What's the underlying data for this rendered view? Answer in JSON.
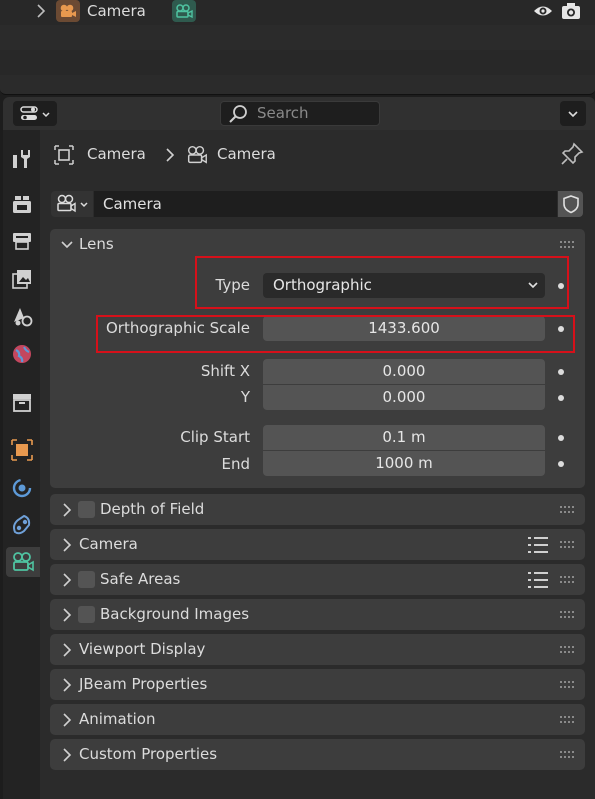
{
  "outliner": {
    "object_name": "Camera"
  },
  "header": {
    "search_placeholder": "Search"
  },
  "breadcrumb": {
    "object": "Camera",
    "data": "Camera"
  },
  "datablock": {
    "name": "Camera"
  },
  "lens": {
    "title": "Lens",
    "type_label": "Type",
    "type_value": "Orthographic",
    "ortho_scale_label": "Orthographic Scale",
    "ortho_scale_value": "1433.600",
    "shift_x_label": "Shift X",
    "shift_x_value": "0.000",
    "shift_y_label": "Y",
    "shift_y_value": "0.000",
    "clip_start_label": "Clip Start",
    "clip_start_value": "0.1 m",
    "clip_end_label": "End",
    "clip_end_value": "1000 m"
  },
  "panels": {
    "depth_of_field": "Depth of Field",
    "camera": "Camera",
    "safe_areas": "Safe Areas",
    "background_images": "Background Images",
    "viewport_display": "Viewport Display",
    "jbeam": "JBeam Properties",
    "animation": "Animation",
    "custom_properties": "Custom Properties"
  },
  "colors": {
    "highlight": "#d6101a",
    "camera_data_green": "#4fc3a1",
    "object_orange": "#e8994f"
  }
}
